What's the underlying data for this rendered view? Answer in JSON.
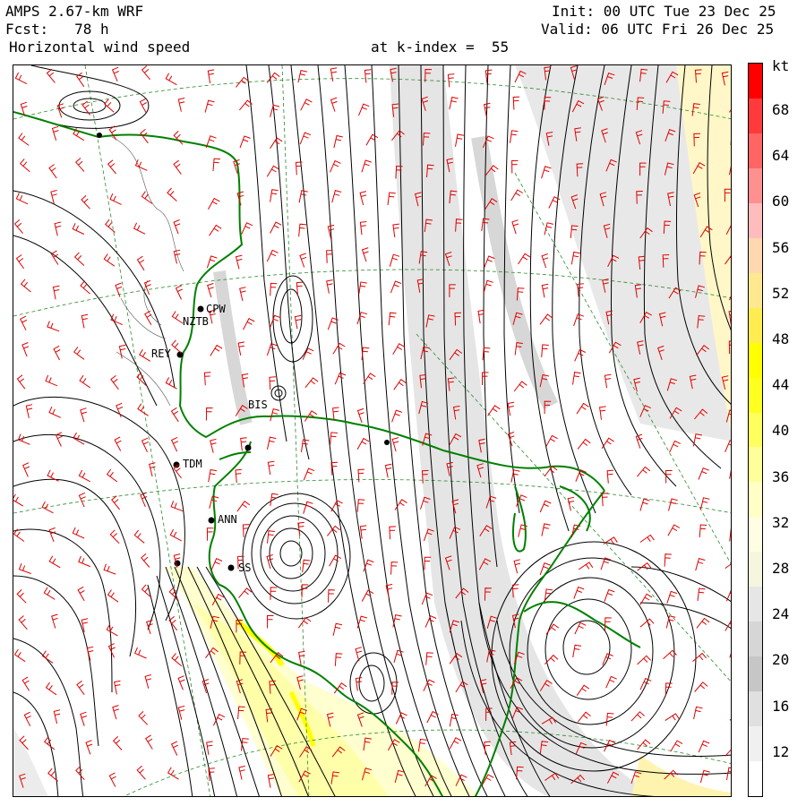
{
  "header": {
    "model": "AMPS 2.67-km WRF",
    "forecast": "Fcst:   78 h",
    "field": "Horizontal wind speed",
    "level": "at k-index =  55",
    "init": "Init: 00 UTC Tue 23 Dec 25",
    "valid": "Valid: 06 UTC Fri 26 Dec 25"
  },
  "colorbar": {
    "unit": "kt",
    "labels": [
      "68",
      "64",
      "60",
      "56",
      "52",
      "48",
      "44",
      "40",
      "36",
      "32",
      "28",
      "24",
      "20",
      "16",
      "12"
    ],
    "colors": [
      "#ff0000",
      "#ff3a3a",
      "#ff6565",
      "#ff9090",
      "#ffbcbc",
      "#ffd8b0",
      "#ffe890",
      "#ffec50",
      "#ffff00",
      "#ffff20",
      "#ffff60",
      "#ffff9a",
      "#ffffc6",
      "#fffde4",
      "#f6f6de",
      "#e6e6e6",
      "#d6d6d6",
      "#c6c6c6",
      "#e0e0e0",
      "#f0f0f0",
      "#ffffff"
    ]
  },
  "stations": [
    {
      "id": "stn-cpw",
      "label": "CPW"
    },
    {
      "id": "stn-nztb",
      "label": "NZTB"
    },
    {
      "id": "stn-rey",
      "label": "REY"
    },
    {
      "id": "stn-bis",
      "label": "BIS"
    },
    {
      "id": "stn-tdm",
      "label": "TDM"
    },
    {
      "id": "stn-ann",
      "label": "ANN"
    },
    {
      "id": "stn-sss",
      "label": "SS"
    }
  ],
  "icons": {
    "wind-barb": "wind-barb-icon",
    "station": "station-dot-icon"
  }
}
